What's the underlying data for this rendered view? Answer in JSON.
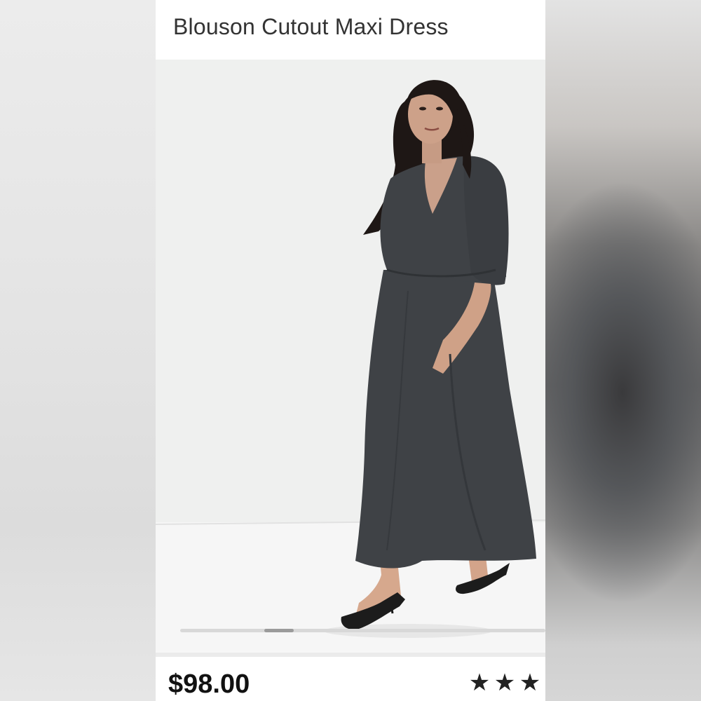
{
  "product": {
    "title": "Blouson Cutout Maxi Dress",
    "price": "$98.00",
    "rating": {
      "stars_visible": 3,
      "partial_star_visible": true,
      "star_glyph": "★"
    }
  },
  "carousel": {
    "position": 0.27
  },
  "colors": {
    "dress": "#3f4246",
    "studio_backdrop": "#f1f2f1",
    "panel_background": "#ffffff",
    "price_text": "#111111"
  }
}
